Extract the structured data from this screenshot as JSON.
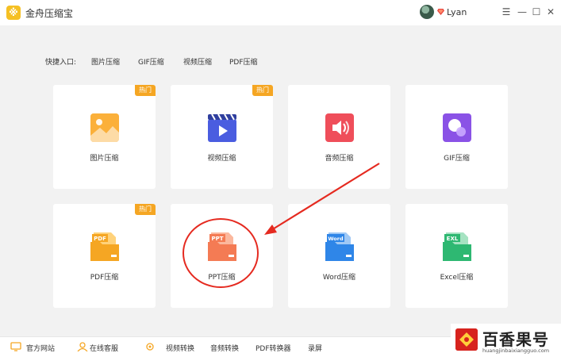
{
  "app": {
    "title": "金舟压缩宝",
    "logo_glyph": "※"
  },
  "user": {
    "name": "Lyan"
  },
  "window": {
    "minimize": "☰",
    "min": "—",
    "max": "☐",
    "close": "✕"
  },
  "quick_entry": {
    "label": "快捷入口:",
    "links": [
      "图片压缩",
      "GIF压缩",
      "视频压缩",
      "PDF压缩"
    ]
  },
  "cards": [
    {
      "label": "图片压缩",
      "badge": "热门",
      "icon": "image-compress-icon",
      "color": "#f5a623"
    },
    {
      "label": "视频压缩",
      "badge": "热门",
      "icon": "video-compress-icon",
      "color": "#4a5de0"
    },
    {
      "label": "音频压缩",
      "badge": "",
      "icon": "audio-compress-icon",
      "color": "#ef4e5a"
    },
    {
      "label": "GIF压缩",
      "badge": "",
      "icon": "gif-compress-icon",
      "color": "#8a52e6"
    },
    {
      "label": "PDF压缩",
      "badge": "热门",
      "icon": "pdf-compress-icon",
      "color": "#f5a623",
      "file_tag": "PDF"
    },
    {
      "label": "PPT压缩",
      "badge": "",
      "icon": "ppt-compress-icon",
      "color": "#f47b54",
      "file_tag": "PPT"
    },
    {
      "label": "Word压缩",
      "badge": "",
      "icon": "word-compress-icon",
      "color": "#2f86e8",
      "file_tag": "Word"
    },
    {
      "label": "Excel压缩",
      "badge": "",
      "icon": "excel-compress-icon",
      "color": "#2eb872",
      "file_tag": "EXL"
    }
  ],
  "bottom": {
    "website": "官方网站",
    "service": "在线客服",
    "links": [
      "视频转换",
      "音频转换",
      "PDF转换器",
      "录屏"
    ]
  },
  "watermark": {
    "text": "百香果号",
    "url": "huangjinbaixiangguo.com"
  },
  "colors": {
    "accent": "#f5a623",
    "annotation": "#e52a20"
  }
}
